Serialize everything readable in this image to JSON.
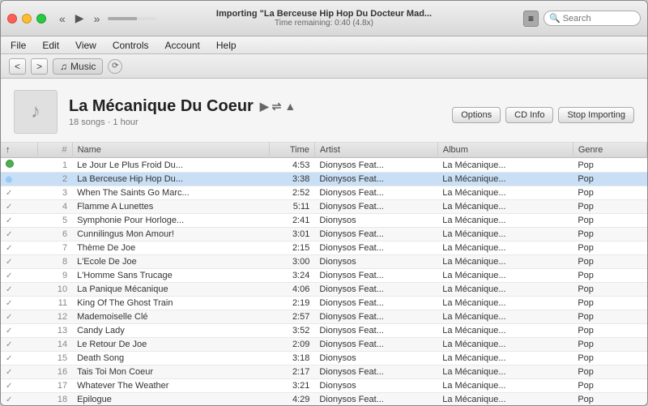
{
  "window": {
    "title": "Importing \"La Berceuse Hip Hop Du Docteur Mad...",
    "subtitle": "Time remaining: 0:40 (4.8x)"
  },
  "titlebar": {
    "buttons": [
      "close",
      "minimize",
      "maximize"
    ],
    "transport": {
      "rewind": "«",
      "play": "▶",
      "fastforward": "»"
    },
    "list_button": "≡",
    "search_placeholder": "Search"
  },
  "menubar": {
    "items": [
      "File",
      "Edit",
      "View",
      "Controls",
      "Account",
      "Help"
    ]
  },
  "toolbar": {
    "back": "<",
    "forward": ">",
    "breadcrumb": "♫ Music",
    "refresh_icon": "⟳"
  },
  "album": {
    "title": "La Mécanique Du Coeur",
    "subtitle": "18 songs · 1 hour",
    "options_btn": "Options",
    "cdinfo_btn": "CD Info",
    "stop_btn": "Stop Importing",
    "play_btn": "▶",
    "shuffle_btn": "⇌",
    "upload_btn": "▲"
  },
  "table": {
    "columns": [
      "",
      "#",
      "Name",
      "Time",
      "Artist",
      "Album",
      "Genre"
    ],
    "rows": [
      {
        "num": "1",
        "status": "done",
        "name": "Le Jour Le Plus Froid Du...",
        "time": "4:53",
        "artist": "Dionysos Feat...",
        "album": "La Mécanique...",
        "genre": "Pop"
      },
      {
        "num": "2",
        "status": "importing",
        "name": "La Berceuse Hip Hop Du...",
        "time": "3:38",
        "artist": "Dionysos Feat...",
        "album": "La Mécanique...",
        "genre": "Pop"
      },
      {
        "num": "3",
        "status": "check",
        "name": "When The Saints Go Marc...",
        "time": "2:52",
        "artist": "Dionysos Feat...",
        "album": "La Mécanique...",
        "genre": "Pop"
      },
      {
        "num": "4",
        "status": "check",
        "name": "Flamme A Lunettes",
        "time": "5:11",
        "artist": "Dionysos Feat...",
        "album": "La Mécanique...",
        "genre": "Pop"
      },
      {
        "num": "5",
        "status": "check",
        "name": "Symphonie Pour Horloge...",
        "time": "2:41",
        "artist": "Dionysos",
        "album": "La Mécanique...",
        "genre": "Pop"
      },
      {
        "num": "6",
        "status": "check",
        "name": "Cunnilingus Mon Amour!",
        "time": "3:01",
        "artist": "Dionysos Feat...",
        "album": "La Mécanique...",
        "genre": "Pop"
      },
      {
        "num": "7",
        "status": "check",
        "name": "Thème De Joe",
        "time": "2:15",
        "artist": "Dionysos Feat...",
        "album": "La Mécanique...",
        "genre": "Pop"
      },
      {
        "num": "8",
        "status": "check",
        "name": "L'Ecole De Joe",
        "time": "3:00",
        "artist": "Dionysos",
        "album": "La Mécanique...",
        "genre": "Pop"
      },
      {
        "num": "9",
        "status": "check",
        "name": "L'Homme Sans Trucage",
        "time": "3:24",
        "artist": "Dionysos Feat...",
        "album": "La Mécanique...",
        "genre": "Pop"
      },
      {
        "num": "10",
        "status": "check",
        "name": "La Panique Mécanique",
        "time": "4:06",
        "artist": "Dionysos Feat...",
        "album": "La Mécanique...",
        "genre": "Pop"
      },
      {
        "num": "11",
        "status": "check",
        "name": "King Of The Ghost Train",
        "time": "2:19",
        "artist": "Dionysos Feat...",
        "album": "La Mécanique...",
        "genre": "Pop"
      },
      {
        "num": "12",
        "status": "check",
        "name": "Mademoiselle Clé",
        "time": "2:57",
        "artist": "Dionysos Feat...",
        "album": "La Mécanique...",
        "genre": "Pop"
      },
      {
        "num": "13",
        "status": "check",
        "name": "Candy Lady",
        "time": "3:52",
        "artist": "Dionysos Feat...",
        "album": "La Mécanique...",
        "genre": "Pop"
      },
      {
        "num": "14",
        "status": "check",
        "name": "Le Retour De Joe",
        "time": "2:09",
        "artist": "Dionysos Feat...",
        "album": "La Mécanique...",
        "genre": "Pop"
      },
      {
        "num": "15",
        "status": "check",
        "name": "Death Song",
        "time": "3:18",
        "artist": "Dionysos",
        "album": "La Mécanique...",
        "genre": "Pop"
      },
      {
        "num": "16",
        "status": "check",
        "name": "Tais Toi Mon Coeur",
        "time": "2:17",
        "artist": "Dionysos Feat...",
        "album": "La Mécanique...",
        "genre": "Pop"
      },
      {
        "num": "17",
        "status": "check",
        "name": "Whatever The Weather",
        "time": "3:21",
        "artist": "Dionysos",
        "album": "La Mécanique...",
        "genre": "Pop"
      },
      {
        "num": "18",
        "status": "check",
        "name": "Epilogue",
        "time": "4:29",
        "artist": "Dionysos Feat...",
        "album": "La Mécanique...",
        "genre": "Pop"
      }
    ]
  }
}
